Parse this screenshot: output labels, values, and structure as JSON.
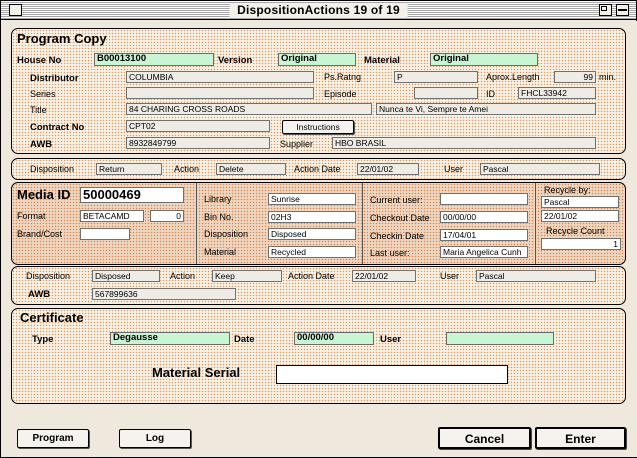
{
  "window": {
    "title": "DispositionActions 19 of 19"
  },
  "program_copy": {
    "heading": "Program Copy",
    "house_no_label": "House No",
    "house_no": "B00013100",
    "version_label": "Version",
    "version": "Original",
    "material_label": "Material",
    "material": "Original",
    "distributor_label": "Distributor",
    "distributor": "COLUMBIA",
    "ps_rating_label": "Ps.Ratng",
    "ps_rating": "P",
    "aprox_length_label": "Aprox.Length",
    "aprox_length": "99",
    "aprox_length_unit": "min.",
    "series_label": "Series",
    "series": "",
    "episode_label": "Episode",
    "episode": "",
    "id_label": "ID",
    "id": "FHCL33942",
    "title_label": "Title",
    "title": "84 CHARING CROSS ROADS",
    "title_alt": "Nunca te Vi, Sempre te Amei",
    "contract_label": "Contract No",
    "contract": "CPT02",
    "instructions_label": "Instructions",
    "awb_label": "AWB",
    "awb": "8932849799",
    "supplier_label": "Supplier",
    "supplier": "HBO BRASIL"
  },
  "disposition_1": {
    "disposition_label": "Disposition",
    "disposition": "Return",
    "action_label": "Action",
    "action": "Delete",
    "action_date_label": "Action Date",
    "action_date": "22/01/02",
    "user_label": "User",
    "user": "Pascal"
  },
  "media": {
    "media_id_label": "Media ID",
    "media_id": "50000469",
    "format_label": "Format",
    "format": "BETACAMD",
    "format_num": "0",
    "brand_label": "Brand/Cost",
    "brand": "",
    "library_label": "Library",
    "library": "Sunrise",
    "bin_label": "Bin No.",
    "bin": "02H3",
    "disposition_label": "Disposition",
    "disposition": "Disposed",
    "material_label": "Material",
    "material": "Recycled",
    "current_user_label": "Current user:",
    "current_user": "",
    "checkout_label": "Checkout Date",
    "checkout": "00/00/00",
    "checkin_label": "Checkin Date",
    "checkin": "17/04/01",
    "last_user_label": "Last user:",
    "last_user": "Maria Angelica Cunh",
    "recycle_by_label": "Recycle by:",
    "recycle_by": "Pascal",
    "recycle_date": "22/01/02",
    "recycle_count_label": "Recycle Count",
    "recycle_count": "1"
  },
  "disposition_2": {
    "disposition_label": "Disposition",
    "disposition": "Disposed",
    "action_label": "Action",
    "action": "Keep",
    "action_date_label": "Action Date",
    "action_date": "22/01/02",
    "user_label": "User",
    "user": "Pascal",
    "awb_label": "AWB",
    "awb": "567899636"
  },
  "certificate": {
    "heading": "Certificate",
    "type_label": "Type",
    "type": "Degausse",
    "date_label": "Date",
    "date": "00/00/00",
    "user_label": "User",
    "user": "",
    "serial_label": "Material Serial",
    "serial": ""
  },
  "buttons": {
    "program": "Program",
    "log": "Log",
    "cancel": "Cancel",
    "enter": "Enter"
  }
}
